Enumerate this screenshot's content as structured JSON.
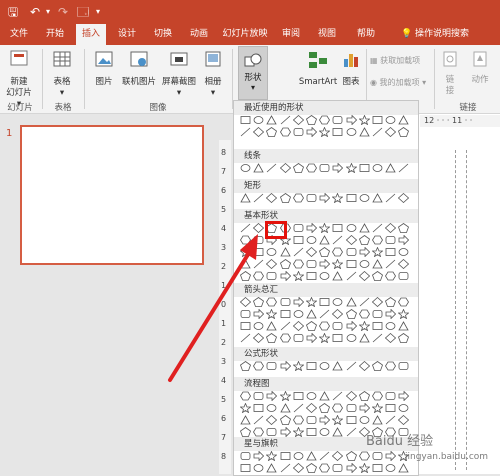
{
  "quick_access": {
    "save": "🖫",
    "undo": "↶",
    "redo": "↷",
    "customize": "🗔"
  },
  "tabs": [
    "文件",
    "开始",
    "插入",
    "设计",
    "切换",
    "动画",
    "幻灯片放映",
    "审阅",
    "视图",
    "帮助",
    "操作说明搜索"
  ],
  "active_tab_index": 2,
  "ribbon": {
    "new_slide": {
      "label1": "新建",
      "label2": "幻灯片 ▾"
    },
    "table": {
      "label": "表格",
      "arrow": "▾"
    },
    "pictures": {
      "label": "图片"
    },
    "online_pictures": {
      "label": "联机图片"
    },
    "screenshot": {
      "label": "屏幕截图",
      "arrow": "▾"
    },
    "album": {
      "label": "相册",
      "arrow": "▾"
    },
    "shapes": {
      "label": "形状",
      "arrow": "▾"
    },
    "smartart": {
      "label": "SmartArt"
    },
    "chart": {
      "label": "图表"
    },
    "get_addins": {
      "label": "获取加载项"
    },
    "my_addins": {
      "label": "我的加载项",
      "arrow": "▾"
    },
    "link": {
      "label1": "链",
      "label2": "接"
    },
    "action": {
      "label": "动作"
    },
    "groups": {
      "slides": "幻灯片",
      "tables": "表格",
      "images": "图像",
      "links": "链接"
    }
  },
  "slide_panel": {
    "slide_number": "1"
  },
  "ruler": {
    "top_numbers": "12 · · · 11 · ·",
    "left_numbers": [
      "8",
      "7",
      "6",
      "5",
      "4",
      "3",
      "2",
      "1",
      "0",
      "1",
      "2",
      "3",
      "4",
      "5",
      "6",
      "7",
      "8"
    ]
  },
  "shapes_menu": {
    "sections": [
      {
        "key": "recent",
        "label": "最近使用的形状"
      },
      {
        "key": "lines",
        "label": "线条"
      },
      {
        "key": "rect",
        "label": "矩形"
      },
      {
        "key": "basic",
        "label": "基本形状"
      },
      {
        "key": "arrows",
        "label": "箭头总汇"
      },
      {
        "key": "equation",
        "label": "公式形状"
      },
      {
        "key": "flowchart",
        "label": "流程图"
      },
      {
        "key": "stars",
        "label": "星与旗帜"
      }
    ],
    "highlighted_shape": "oval"
  },
  "colors": {
    "accent": "#c5442a",
    "highlight": "#e3120b",
    "arrow": "#e02020",
    "thumb_border": "#d55d43"
  },
  "watermark": {
    "main": "Baidu 经验",
    "sub": "jingyan.baidu.com"
  }
}
